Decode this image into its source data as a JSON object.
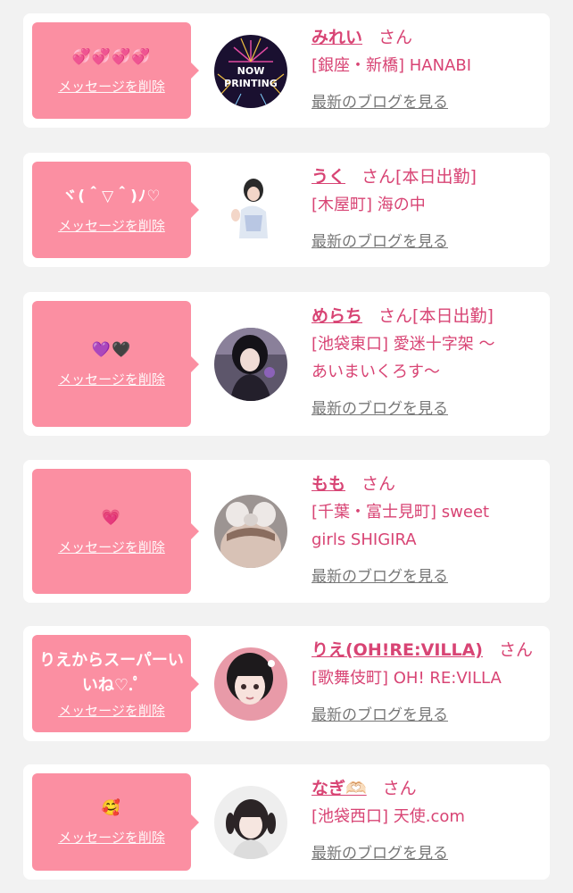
{
  "colors": {
    "background": "#f2f2f2",
    "card": "#ffffff",
    "bubble": "#fb8fa2",
    "accent": "#d84474",
    "link_gray": "#777777"
  },
  "items": [
    {
      "message": "💞💞💞💞",
      "delete_label": "メッセージを削除",
      "name": "みれい",
      "suffix": "さん",
      "status": "",
      "shop_lines": [
        "[銀座・新橋] HANABI"
      ],
      "blog_label": "最新のブログを見る",
      "avatar_text": "NOW\nPRINTING"
    },
    {
      "message": "ヾ(＾▽＾)ﾉ♡",
      "delete_label": "メッセージを削除",
      "name": "うく",
      "suffix": "さん",
      "status": "[本日出勤]",
      "shop_lines": [
        "[木屋町] 海の中"
      ],
      "blog_label": "最新のブログを見る"
    },
    {
      "message": "💜🖤",
      "delete_label": "メッセージを削除",
      "name": "めらち",
      "suffix": "さん",
      "status": "[本日出勤]",
      "shop_lines": [
        "[池袋東口] 愛迷十字架 〜",
        "あいまいくろす〜"
      ],
      "blog_label": "最新のブログを見る"
    },
    {
      "message": "💗",
      "delete_label": "メッセージを削除",
      "name": "もも",
      "suffix": "さん",
      "status": "",
      "shop_lines": [
        "[千葉・富士見町] sweet",
        "girls SHIGIRA"
      ],
      "blog_label": "最新のブログを見る"
    },
    {
      "message": "りえからスーパーいいね♡.ﾟ",
      "delete_label": "メッセージを削除",
      "name": "りえ(OH!RE:VILLA)",
      "suffix": "さん",
      "status": "",
      "shop_lines": [
        "[歌舞伎町] OH! RE:VILLA"
      ],
      "blog_label": "最新のブログを見る"
    },
    {
      "message": "🥰",
      "delete_label": "メッセージを削除",
      "name": "なぎ🫶🏻",
      "suffix": "さん",
      "status": "",
      "shop_lines": [
        "[池袋西口] 天使.com"
      ],
      "blog_label": "最新のブログを見る"
    }
  ]
}
